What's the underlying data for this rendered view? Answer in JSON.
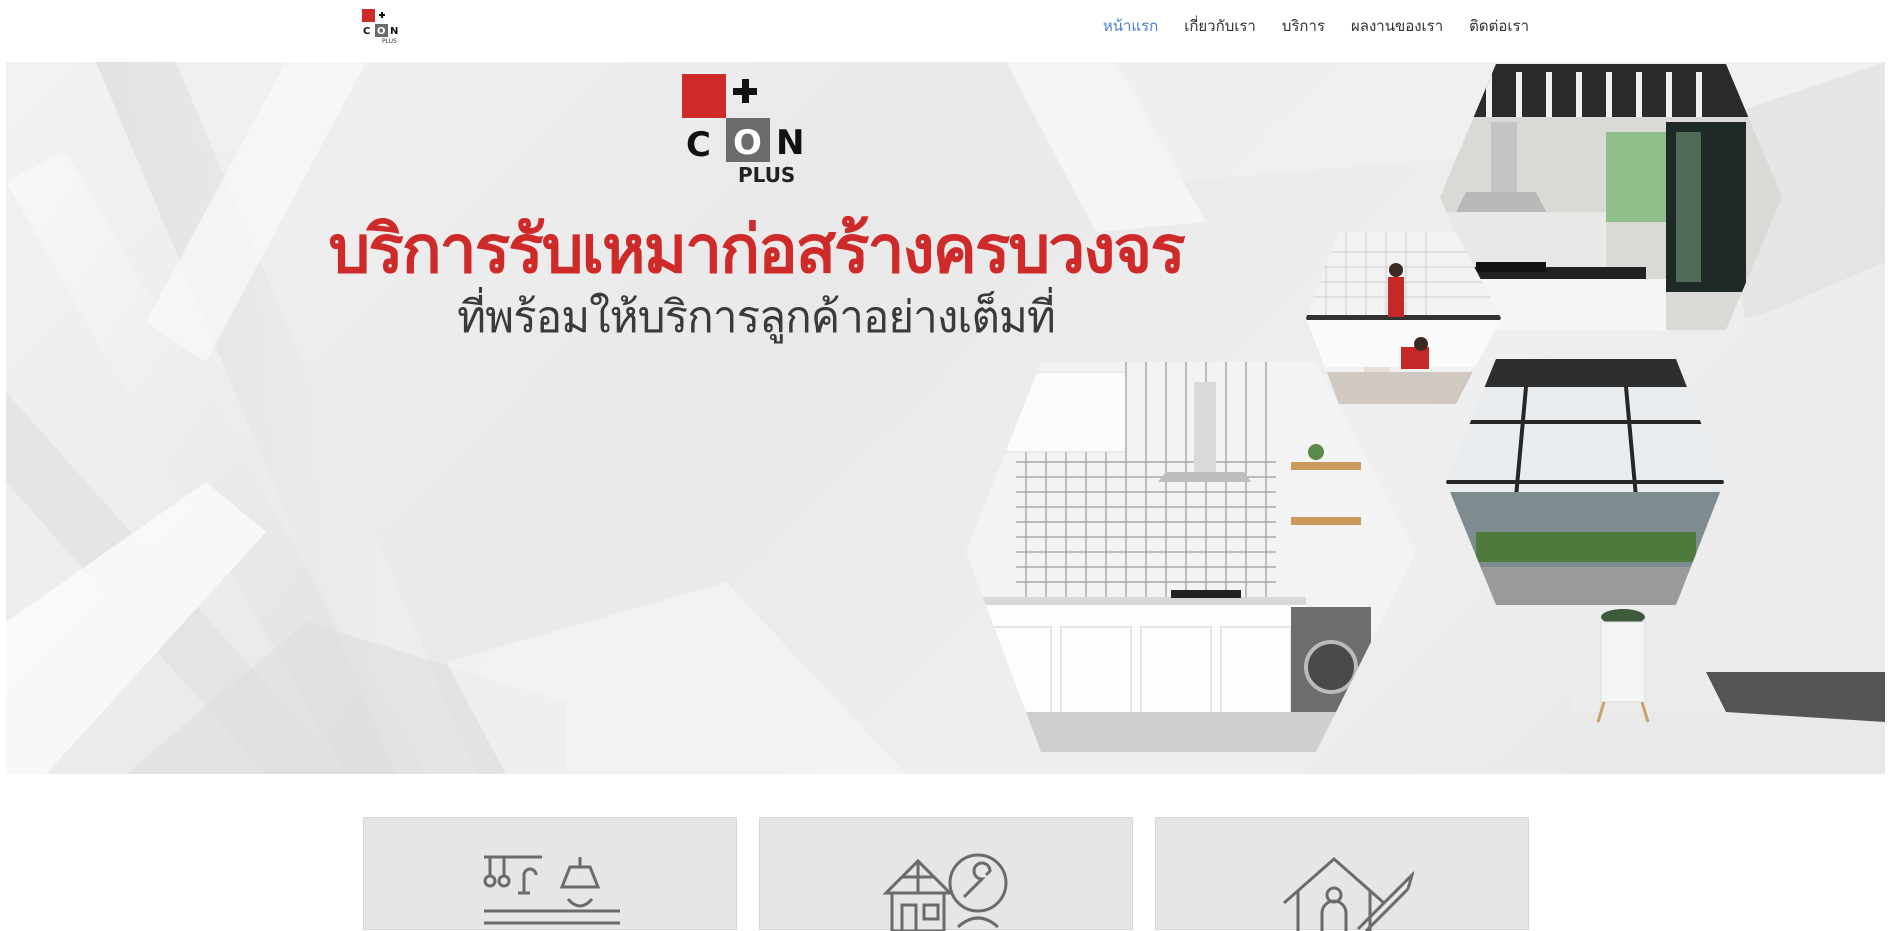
{
  "brand": {
    "logo_top": "C",
    "logo_o": "O",
    "logo_n": "N",
    "logo_plus": "PLUS",
    "logo_name": "CON PLUS",
    "red": "#cf2a2a",
    "gray": "#6b6b6b"
  },
  "nav": {
    "items": [
      {
        "label": "หน้าแรก",
        "active": true
      },
      {
        "label": "เกี่ยวกับเรา",
        "active": false
      },
      {
        "label": "บริการ",
        "active": false
      },
      {
        "label": "ผลงานของเรา",
        "active": false
      },
      {
        "label": "ติดต่อเรา",
        "active": false
      }
    ],
    "active_color": "#4a7fd0"
  },
  "hero": {
    "headline": "บริการรับเหมาก่อสร้างครบวงจร",
    "subline": "ที่พร้อมให้บริการลูกค้าอย่างเต็มที่",
    "photos": [
      "kitchen-hood-photo",
      "workers-installing-photo",
      "kitchen-photo",
      "roof-structure-photo"
    ]
  },
  "services": {
    "cards": [
      {
        "icon": "kitchen-icon"
      },
      {
        "icon": "house-repair-icon"
      },
      {
        "icon": "house-design-icon"
      }
    ]
  }
}
